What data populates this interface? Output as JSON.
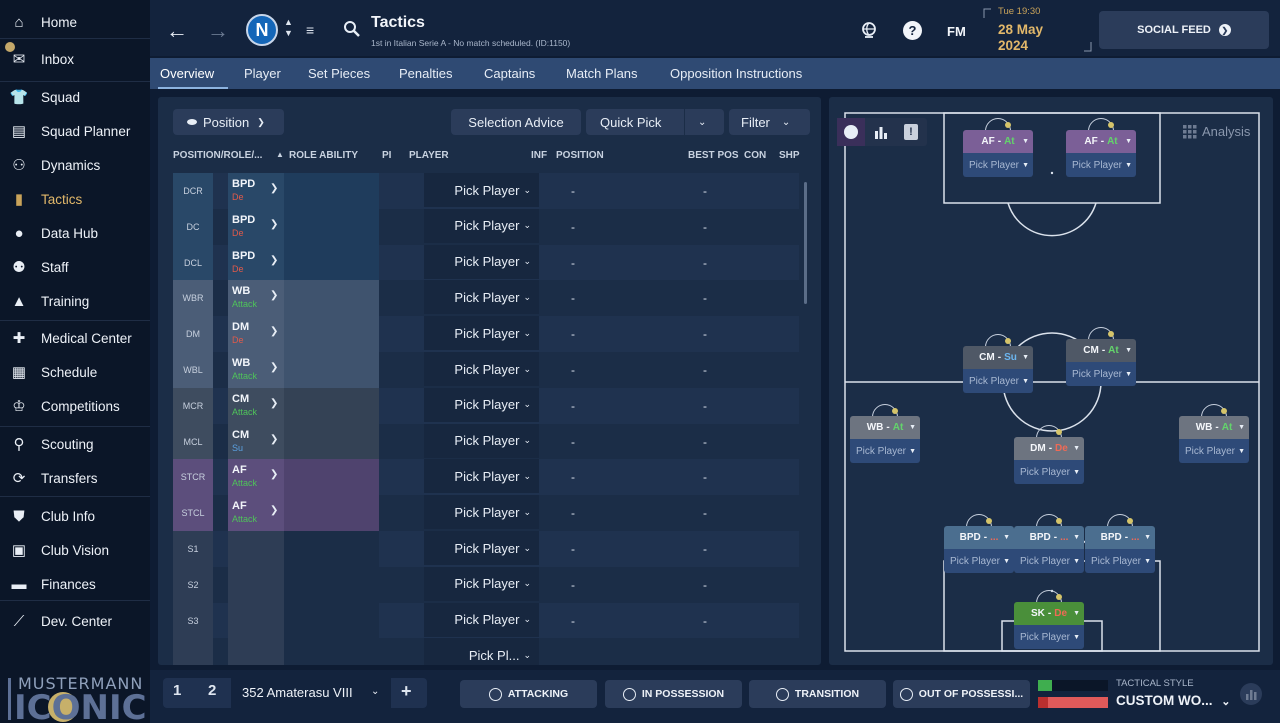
{
  "sidebar": {
    "items": [
      {
        "label": "Home",
        "icon": "home-icon"
      },
      {
        "label": "Inbox",
        "icon": "inbox-icon"
      },
      {
        "label": "Squad",
        "icon": "shirt-icon"
      },
      {
        "label": "Squad Planner",
        "icon": "clipboard-icon"
      },
      {
        "label": "Dynamics",
        "icon": "dynamics-icon"
      },
      {
        "label": "Tactics",
        "icon": "tactics-board-icon"
      },
      {
        "label": "Data Hub",
        "icon": "data-hub-icon"
      },
      {
        "label": "Staff",
        "icon": "staff-icon"
      },
      {
        "label": "Training",
        "icon": "training-cone-icon"
      },
      {
        "label": "Medical Center",
        "icon": "medical-kit-icon"
      },
      {
        "label": "Schedule",
        "icon": "calendar-icon"
      },
      {
        "label": "Competitions",
        "icon": "trophy-icon"
      },
      {
        "label": "Scouting",
        "icon": "magnifier-icon"
      },
      {
        "label": "Transfers",
        "icon": "transfer-arrows-icon"
      },
      {
        "label": "Club Info",
        "icon": "shield-icon"
      },
      {
        "label": "Club Vision",
        "icon": "briefcase-icon"
      },
      {
        "label": "Finances",
        "icon": "money-icon"
      },
      {
        "label": "Dev. Center",
        "icon": "trend-line-icon"
      }
    ],
    "active": "Tactics",
    "logo_line1": "MUSTERMANN",
    "logo_line2": "ICONIC"
  },
  "header": {
    "title": "Tactics",
    "subtitle": "1st in Italian Serie A - No match scheduled. (ID:1150)",
    "club_badge": "N",
    "fm_label": "FM",
    "date_time": "Tue 19:30",
    "date_day": "28 May",
    "date_year": "2024",
    "social_label": "SOCIAL FEED"
  },
  "tabs": [
    "Overview",
    "Player",
    "Set Pieces",
    "Penalties",
    "Captains",
    "Match Plans",
    "Opposition Instructions"
  ],
  "left_panel": {
    "position_dropdown": "Position",
    "selection_advice": "Selection Advice",
    "quick_pick": "Quick Pick",
    "filter": "Filter",
    "columns": [
      "POSITION/ROLE/...",
      "ROLE ABILITY",
      "PI",
      "PLAYER",
      "INF",
      "POSITION",
      "BEST POS",
      "CON",
      "SHP"
    ],
    "rows": [
      {
        "pos": "DCR",
        "role": "BPD",
        "duty": "De",
        "duty_color": "#e05a4a",
        "group": "def",
        "player": "Pick Player",
        "position": "-",
        "best": "-"
      },
      {
        "pos": "DC",
        "role": "BPD",
        "duty": "De",
        "duty_color": "#e05a4a",
        "group": "def",
        "player": "Pick Player",
        "position": "-",
        "best": "-"
      },
      {
        "pos": "DCL",
        "role": "BPD",
        "duty": "De",
        "duty_color": "#e05a4a",
        "group": "def",
        "player": "Pick Player",
        "position": "-",
        "best": "-"
      },
      {
        "pos": "WBR",
        "role": "WB",
        "duty": "Attack",
        "duty_color": "#4fc35a",
        "group": "wb",
        "player": "Pick Player",
        "position": "-",
        "best": "-"
      },
      {
        "pos": "DM",
        "role": "DM",
        "duty": "De",
        "duty_color": "#e05a4a",
        "group": "wb",
        "player": "Pick Player",
        "position": "-",
        "best": "-"
      },
      {
        "pos": "WBL",
        "role": "WB",
        "duty": "Attack",
        "duty_color": "#4fc35a",
        "group": "wb",
        "player": "Pick Player",
        "position": "-",
        "best": "-"
      },
      {
        "pos": "MCR",
        "role": "CM",
        "duty": "Attack",
        "duty_color": "#4fc35a",
        "group": "mid",
        "player": "Pick Player",
        "position": "-",
        "best": "-"
      },
      {
        "pos": "MCL",
        "role": "CM",
        "duty": "Su",
        "duty_color": "#5aa0e0",
        "group": "mid",
        "player": "Pick Player",
        "position": "-",
        "best": "-"
      },
      {
        "pos": "STCR",
        "role": "AF",
        "duty": "Attack",
        "duty_color": "#4fc35a",
        "group": "att",
        "player": "Pick Player",
        "position": "-",
        "best": "-"
      },
      {
        "pos": "STCL",
        "role": "AF",
        "duty": "Attack",
        "duty_color": "#4fc35a",
        "group": "att",
        "player": "Pick Player",
        "position": "-",
        "best": "-"
      },
      {
        "pos": "S1",
        "role": "",
        "duty": "",
        "duty_color": "#ffffff",
        "group": "sub",
        "player": "Pick Player",
        "position": "-",
        "best": "-"
      },
      {
        "pos": "S2",
        "role": "",
        "duty": "",
        "duty_color": "#ffffff",
        "group": "sub",
        "player": "Pick Player",
        "position": "-",
        "best": "-"
      },
      {
        "pos": "S3",
        "role": "",
        "duty": "",
        "duty_color": "#ffffff",
        "group": "sub",
        "player": "Pick Player",
        "position": "-",
        "best": "-"
      },
      {
        "pos": "",
        "role": "",
        "duty": "",
        "duty_color": "#ffffff",
        "group": "sub",
        "player": "Pick Pl...",
        "position": "",
        "best": ""
      }
    ]
  },
  "pitch": {
    "analysis_label": "Analysis",
    "cards": [
      {
        "role": "AF",
        "duty": "At",
        "duty_color": "#63d46b",
        "kind": "att",
        "player": "Pick Player"
      },
      {
        "role": "AF",
        "duty": "At",
        "duty_color": "#63d46b",
        "kind": "att",
        "player": "Pick Player"
      },
      {
        "role": "CM",
        "duty": "Su",
        "duty_color": "#6cb6f0",
        "kind": "mid",
        "player": "Pick Player"
      },
      {
        "role": "CM",
        "duty": "At",
        "duty_color": "#63d46b",
        "kind": "mid",
        "player": "Pick Player"
      },
      {
        "role": "WB",
        "duty": "At",
        "duty_color": "#63d46b",
        "kind": "wb",
        "player": "Pick Player"
      },
      {
        "role": "DM",
        "duty": "De",
        "duty_color": "#f06a55",
        "kind": "wb",
        "player": "Pick Player"
      },
      {
        "role": "WB",
        "duty": "At",
        "duty_color": "#63d46b",
        "kind": "wb",
        "player": "Pick Player"
      },
      {
        "role": "BPD",
        "duty": "...",
        "duty_color": "#f06a55",
        "kind": "def",
        "player": "Pick Player"
      },
      {
        "role": "BPD",
        "duty": "...",
        "duty_color": "#f06a55",
        "kind": "def",
        "player": "Pick Player"
      },
      {
        "role": "BPD",
        "duty": "...",
        "duty_color": "#f06a55",
        "kind": "def",
        "player": "Pick Player"
      },
      {
        "role": "SK",
        "duty": "De",
        "duty_color": "#f06a55",
        "kind": "gk",
        "player": "Pick Player"
      }
    ]
  },
  "bottom": {
    "slot1": "1",
    "slot2": "2",
    "tactic_name": "352 Amaterasu VIII",
    "add": "+",
    "phases": [
      "ATTACKING",
      "IN POSSESSION",
      "TRANSITION",
      "OUT OF POSSESSI..."
    ],
    "style_label": "TACTICAL STYLE",
    "style_value": "CUSTOM WO..."
  }
}
